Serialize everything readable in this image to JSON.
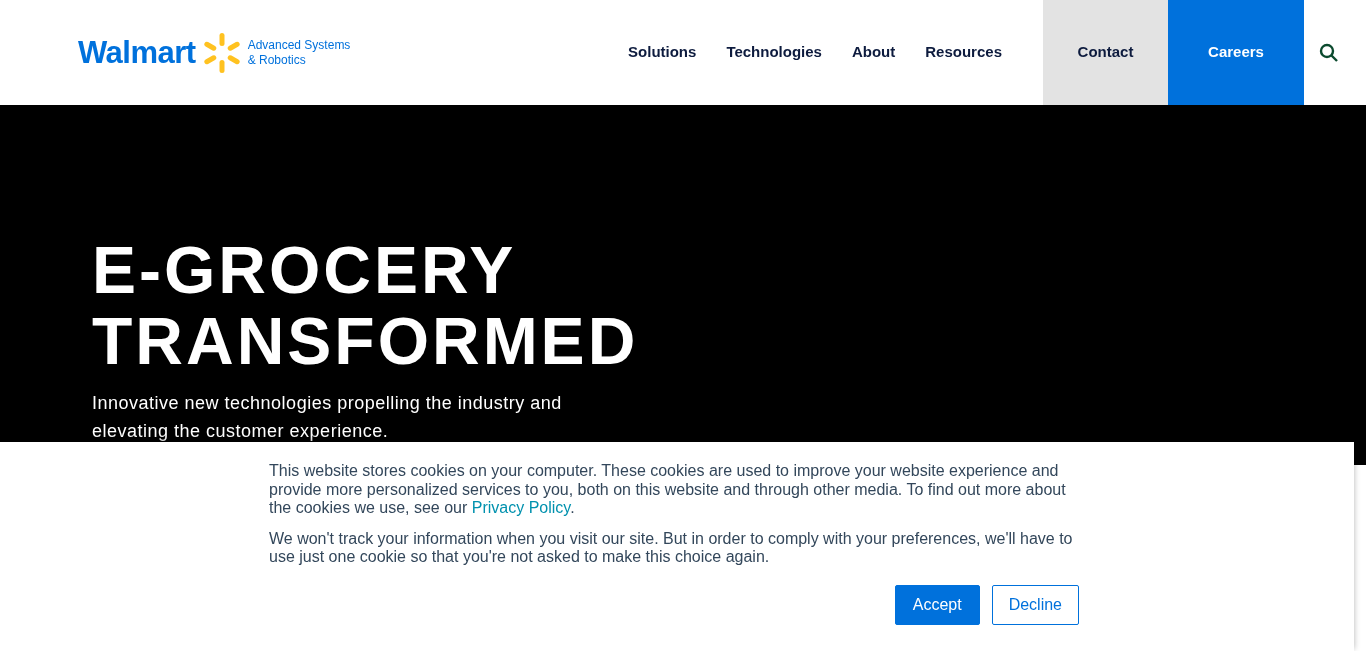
{
  "header": {
    "logo": {
      "wordmark": "Walmart",
      "tagline": [
        "Advanced Systems",
        "& Robotics"
      ]
    },
    "nav": [
      {
        "label": "Solutions",
        "kind": "link"
      },
      {
        "label": "Technologies",
        "kind": "link"
      },
      {
        "label": "About",
        "kind": "link"
      },
      {
        "label": "Resources",
        "kind": "link"
      },
      {
        "label": "Contact",
        "kind": "secondary"
      },
      {
        "label": "Careers",
        "kind": "primary"
      }
    ]
  },
  "hero": {
    "title": [
      "E-GROCERY",
      "TRANSFORMED"
    ],
    "subtitle": "Innovative new technologies propelling the industry and elevating the customer experience."
  },
  "cookie_banner": {
    "paragraphs": [
      {
        "text": "This website stores cookies on your computer. These cookies are used to improve your website experience and provide more personalized services to you, both on this website and through other media. To find out more about the cookies we use, see our ",
        "link": "Privacy Policy",
        "after": "."
      },
      {
        "text": "We won't track your information when you visit our site. But in order to comply with your preferences, we'll have to use just one cookie so that you're not asked to make this choice again."
      }
    ],
    "buttons": [
      {
        "label": "Accept",
        "kind": "primary"
      },
      {
        "label": "Decline",
        "kind": "outline"
      }
    ]
  }
}
